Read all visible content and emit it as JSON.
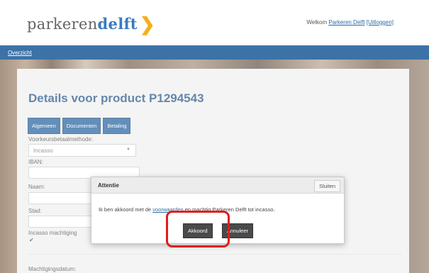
{
  "header": {
    "logo_text_part1": "parkeren",
    "logo_text_part2": "delft",
    "logo_chevron": "❯",
    "welcome_prefix": "Welkom",
    "user_name": "Parkeren Delft",
    "logout_label": "[Uitloggen]"
  },
  "nav": {
    "overview_label": "Overzicht"
  },
  "page": {
    "title": "Details voor product P1294543",
    "tabs": [
      {
        "label": "Algemeen"
      },
      {
        "label": "Documenten"
      },
      {
        "label": "Betaling"
      }
    ],
    "form": {
      "payment_method_label": "Voorkeursbetaalmethode:",
      "payment_method_value": "Incasso",
      "iban_label": "IBAN:",
      "iban_value": "",
      "name_label": "Naam:",
      "name_value": "",
      "city_label": "Stad:",
      "city_value": "",
      "mandate_label": "Incasso machtiging",
      "mandate_checked": true,
      "mandate_date_label": "Machtigingsdatum:"
    }
  },
  "dialog": {
    "title": "Attentie",
    "close_label": "Sluiten",
    "text_before": "Ik ben akkoord met de ",
    "link_text": "voorwaarden",
    "text_after": " en machtig Parkeren Delft tot incasso.",
    "accept_label": "Akkoord",
    "cancel_label": "Annuleer"
  },
  "colors": {
    "accent_blue": "#3c72a6",
    "title_blue": "#2f5f8f",
    "logo_yellow": "#f2b01e",
    "highlight_red": "#e01b1b"
  }
}
